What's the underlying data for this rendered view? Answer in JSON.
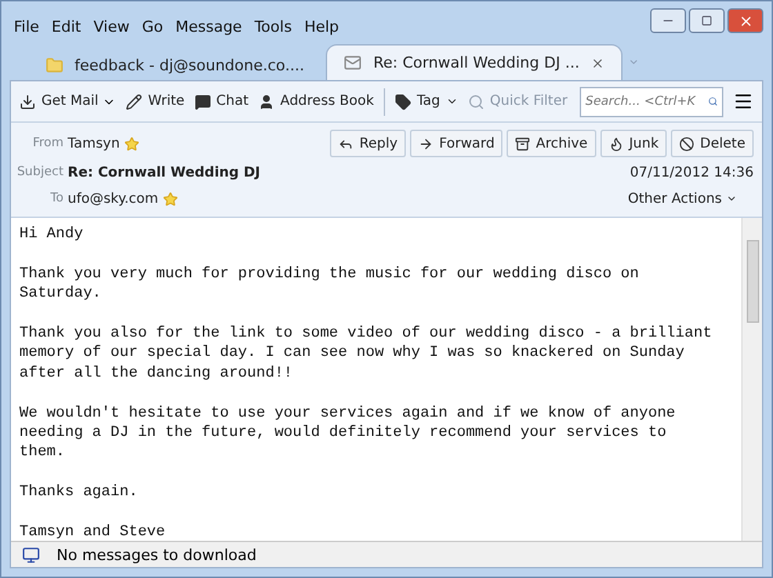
{
  "menu": [
    "File",
    "Edit",
    "View",
    "Go",
    "Message",
    "Tools",
    "Help"
  ],
  "tabs": [
    {
      "label": "feedback - dj@soundone.co....",
      "kind": "folder",
      "selected": false
    },
    {
      "label": "Re: Cornwall Wedding DJ ...",
      "kind": "message",
      "selected": true
    }
  ],
  "toolbar": {
    "items": [
      {
        "label": "Get Mail",
        "kind": "getmail"
      },
      {
        "label": "Write",
        "kind": "write"
      },
      {
        "label": "Chat",
        "kind": "chat"
      },
      {
        "label": "Address Book",
        "kind": "address"
      },
      {
        "label": "Tag",
        "kind": "tag"
      },
      {
        "label": "Quick Filter",
        "kind": "filter",
        "disabled": true
      }
    ],
    "search": {
      "placeholder": "Search... <Ctrl+K"
    }
  },
  "header": {
    "from_label": "From",
    "from": "Tamsyn",
    "subject_label": "Subject",
    "subject": "Re: Cornwall Wedding DJ",
    "to_label": "To",
    "to": "ufo@sky.com",
    "date": "07/11/2012 14:36",
    "other_actions": "Other Actions",
    "actions": [
      {
        "label": "Reply",
        "kind": "reply"
      },
      {
        "label": "Forward",
        "kind": "forward"
      },
      {
        "label": "Archive",
        "kind": "archive"
      },
      {
        "label": "Junk",
        "kind": "junk"
      },
      {
        "label": "Delete",
        "kind": "delete"
      }
    ]
  },
  "body": [
    "Hi Andy",
    "Thank you very much for providing the music for our wedding disco on\nSaturday.",
    "Thank you also for the link to some video of our wedding disco - a brilliant\nmemory of our special day. I can see now why I was so knackered on Sunday\nafter all the dancing around!!",
    "We wouldn't hesitate to use your services again and if we know of anyone\nneeding a DJ in the future, would definitely recommend your services to\nthem.",
    "Thanks again.",
    "Tamsyn and Steve"
  ],
  "status_bar": {
    "text": "No messages to download"
  }
}
